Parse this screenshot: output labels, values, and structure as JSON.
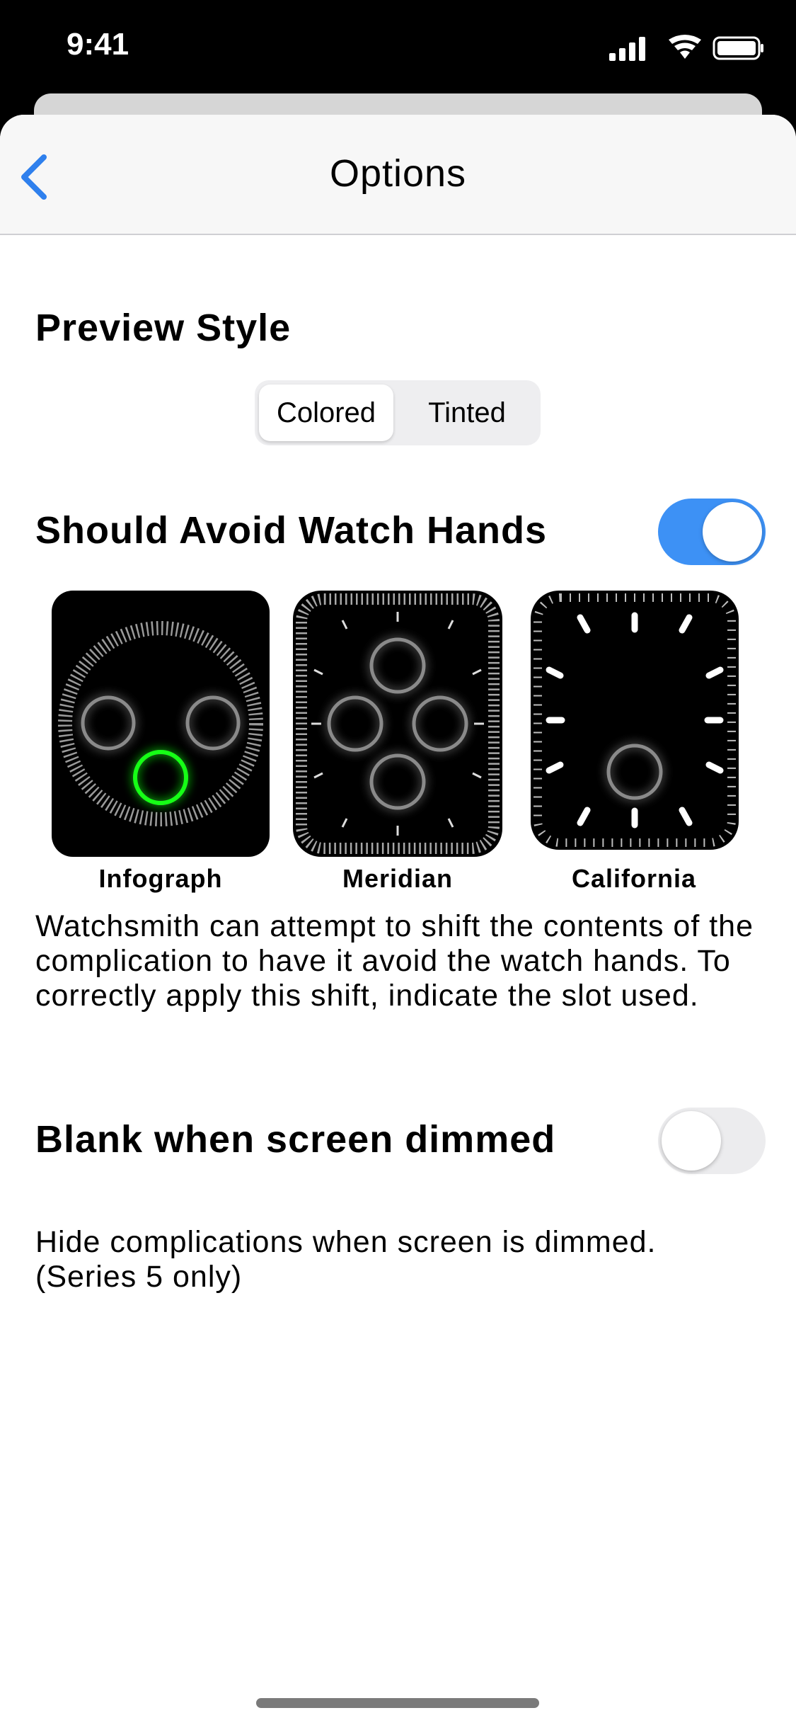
{
  "status_bar": {
    "time": "9:41",
    "icons": [
      "signal-icon",
      "wifi-icon",
      "battery-icon"
    ]
  },
  "nav": {
    "back_icon": "chevron-left-icon",
    "title": "Options"
  },
  "preview_style": {
    "title": "Preview Style",
    "segments": [
      "Colored",
      "Tinted"
    ],
    "selected": "Colored"
  },
  "avoid_hands": {
    "title": "Should Avoid Watch Hands",
    "toggle_on": true,
    "faces": [
      {
        "label": "Infograph"
      },
      {
        "label": "Meridian"
      },
      {
        "label": "California"
      }
    ],
    "description": "Watchsmith can attempt to shift the contents of the complication to have it avoid the watch hands.  To correctly apply this shift, indicate the slot used."
  },
  "blank_dimmed": {
    "title": "Blank when screen dimmed",
    "toggle_on": false,
    "description": "Hide complications when screen is dimmed. (Series 5 only)"
  },
  "colors": {
    "accent": "#3d91f5",
    "slot_selected": "#19ff19",
    "slot_glow": "#2edc2e",
    "slot_ring": "#8a8a8a"
  }
}
